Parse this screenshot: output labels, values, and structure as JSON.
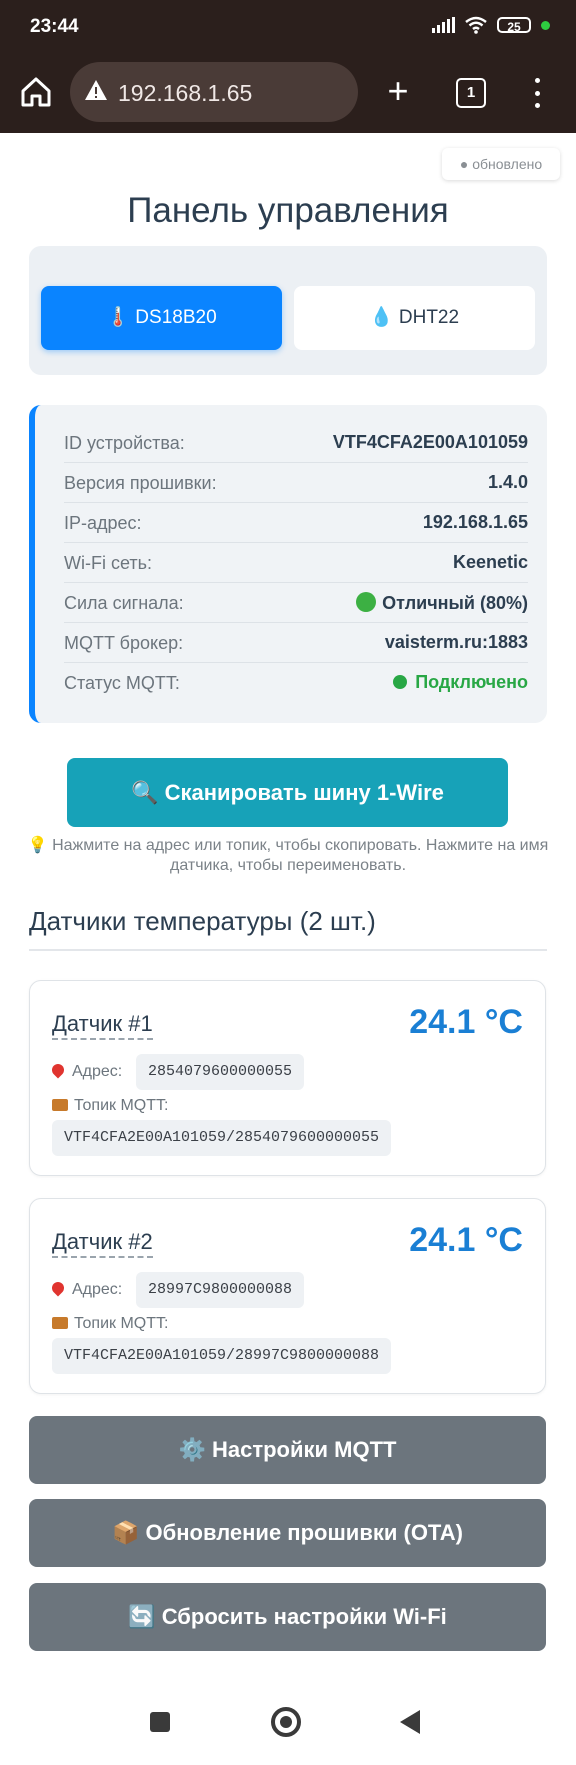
{
  "status_bar": {
    "time": "23:44",
    "battery": "25"
  },
  "browser": {
    "url": "192.168.1.65",
    "tab_count": "1"
  },
  "page": {
    "updated_badge": "● обновлено",
    "title": "Панель управления",
    "tabs": [
      {
        "icon": "🌡️",
        "label": "DS18B20",
        "active": true
      },
      {
        "icon": "💧",
        "label": "DHT22",
        "active": false
      }
    ],
    "info": {
      "device_id": {
        "label": "ID устройства:",
        "value": "VTF4CFA2E00A101059"
      },
      "firmware": {
        "label": "Версия прошивки:",
        "value": "1.4.0"
      },
      "ip": {
        "label": "IP-адрес:",
        "value": "192.168.1.65"
      },
      "wifi": {
        "label": "Wi-Fi сеть:",
        "value": "Keenetic"
      },
      "signal": {
        "label": "Сила сигнала:",
        "value": "Отличный (80%)"
      },
      "mqtt_broker": {
        "label": "MQTT брокер:",
        "value": "vaisterm.ru:1883"
      },
      "mqtt_status": {
        "label": "Статус MQTT:",
        "value": "Подключено"
      }
    },
    "scan_button": "🔍 Сканировать шину 1-Wire",
    "hint": "💡 Нажмите на адрес или топик, чтобы скопировать. Нажмите на имя датчика, чтобы переименовать.",
    "section_title": "Датчики температуры (2 шт.)",
    "address_label": "Адрес:",
    "topic_label": "Топик MQTT:",
    "sensors": [
      {
        "name": "Датчик #1",
        "temp": "24.1 °C",
        "address": "2854079600000055",
        "topic": "VTF4CFA2E00A101059/2854079600000055"
      },
      {
        "name": "Датчик #2",
        "temp": "24.1 °C",
        "address": "28997C9800000088",
        "topic": "VTF4CFA2E00A101059/28997C9800000088"
      }
    ],
    "buttons": {
      "mqtt": "⚙️ Настройки MQTT",
      "ota": "📦 Обновление прошивки (OTA)",
      "wifi_reset": "🔄 Сбросить настройки Wi-Fi"
    }
  },
  "colors": {
    "accent": "#0a84ff",
    "scan": "#17a2b8",
    "ok": "#28a745",
    "secondary": "#6c757d"
  }
}
